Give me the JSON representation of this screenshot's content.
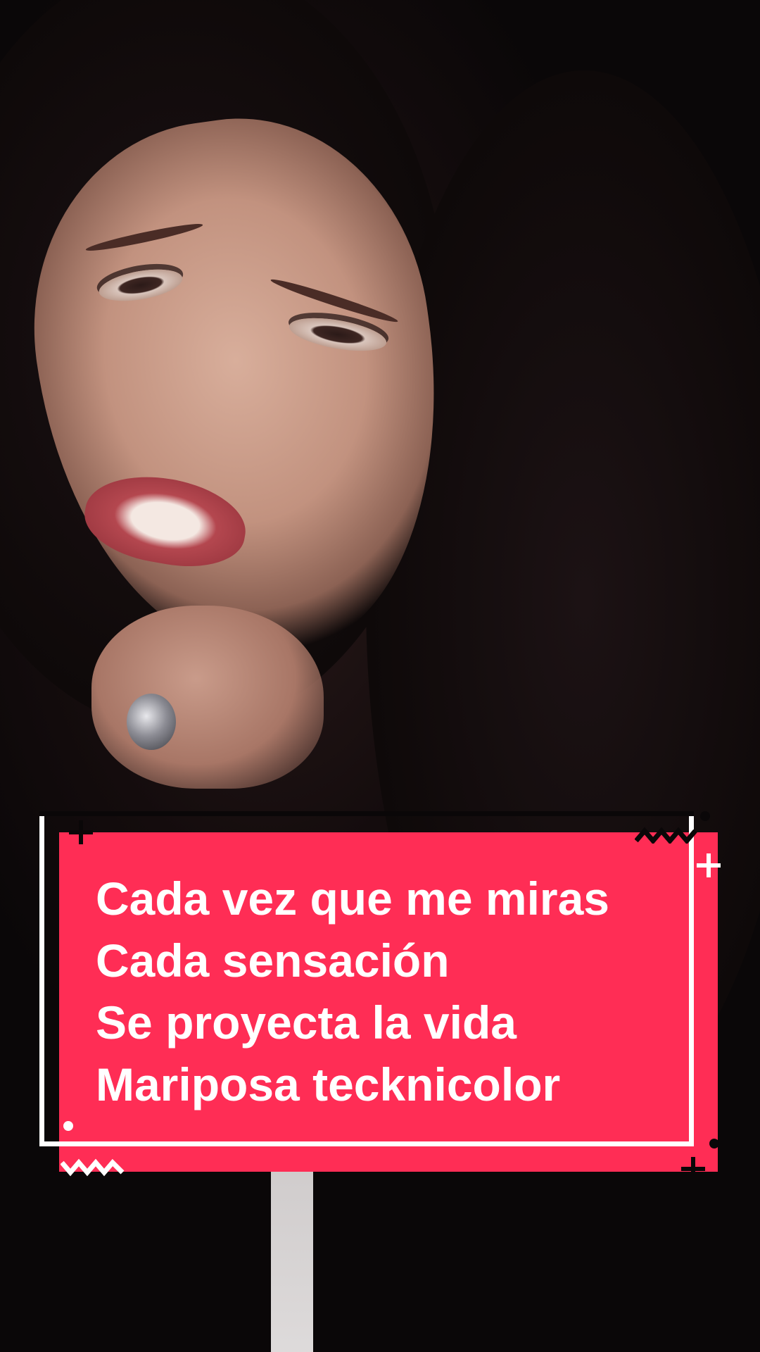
{
  "lyrics": {
    "lines": [
      "Cada vez que me miras",
      "Cada sensación",
      "Se proyecta la vida",
      "Mariposa tecknicolor"
    ]
  },
  "colors": {
    "card_background": "#ff2d55",
    "text": "#ffffff",
    "background": "#0a0708"
  },
  "decorations": [
    "plus-icon",
    "zigzag-icon",
    "dot-icon"
  ]
}
